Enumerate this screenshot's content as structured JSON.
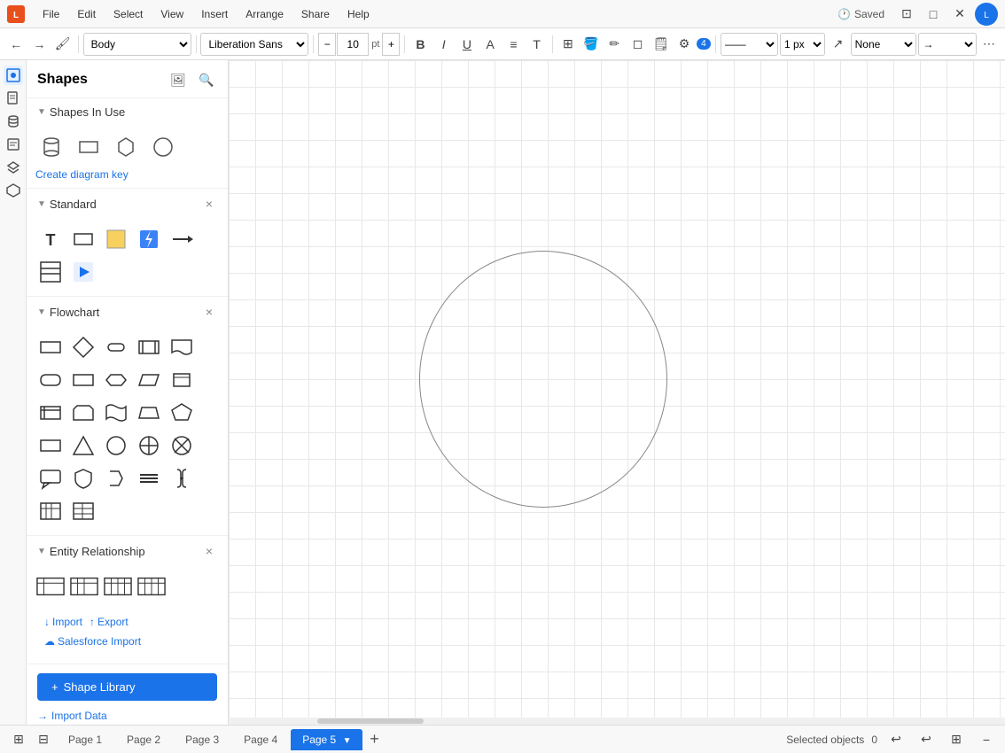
{
  "menubar": {
    "file": "File",
    "edit": "Edit",
    "select": "Select",
    "view": "View",
    "insert": "Insert",
    "arrange": "Arrange",
    "share": "Share",
    "help": "Help",
    "saved": "Saved"
  },
  "toolbar": {
    "font_family": "Liberation Sans",
    "font_size": "10",
    "font_size_unit": "pt",
    "style_placeholder": "Body",
    "line_style": "None",
    "line_px": "1 px",
    "badge_count": "4"
  },
  "sidebar": {
    "title": "Shapes",
    "shapes_in_use_label": "Shapes In Use",
    "create_diagram_key": "Create diagram key",
    "standard_label": "Standard",
    "flowchart_label": "Flowchart",
    "entity_relationship_label": "Entity Relationship",
    "import_label": "Import",
    "export_label": "Export",
    "salesforce_import_label": "Salesforce Import",
    "shape_library_label": "Shape Library",
    "import_data_label": "Import Data"
  },
  "pages": [
    {
      "label": "Page 1"
    },
    {
      "label": "Page 2"
    },
    {
      "label": "Page 3"
    },
    {
      "label": "Page 4"
    },
    {
      "label": "Page 5",
      "active": true
    }
  ],
  "status": {
    "selected_objects": "Selected objects",
    "count": "0"
  },
  "colors": {
    "accent": "#1a73e8",
    "active_tab": "#1a73e8"
  }
}
